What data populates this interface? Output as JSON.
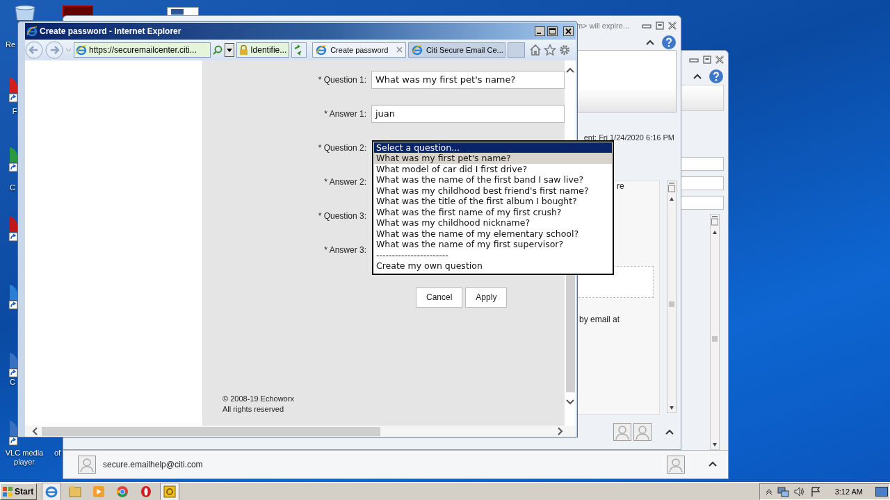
{
  "desktop_icons": [
    {
      "label": "Re"
    },
    {
      "label": "F"
    },
    {
      "label": "C"
    },
    {
      "label": "C"
    },
    {
      "label": "VLC media player"
    },
    {
      "label": "of"
    }
  ],
  "mail_window": {
    "title": "m> will expire...",
    "sent": "ent: Fri 1/24/2020 6:16 PM",
    "body_fragment": "re",
    "body_text": "by email at",
    "contact": "secure.emailhelp@citi.com"
  },
  "browser": {
    "title": "Create password - Internet Explorer",
    "address": "https://securemailcenter.citi...",
    "identity": "Identifie...",
    "tabs": [
      {
        "label": "Create password",
        "selected": true
      },
      {
        "label": "Citi Secure Email Ce...",
        "selected": false
      }
    ]
  },
  "form": {
    "rows": [
      {
        "label": "* Question 1:",
        "value": "What was my first pet's name?"
      },
      {
        "label": "* Answer 1:",
        "value": "juan"
      },
      {
        "label": "* Question 2:"
      },
      {
        "label": "* Answer 2:"
      },
      {
        "label": "* Question 3:"
      },
      {
        "label": "* Answer 3:"
      }
    ],
    "dropdown": {
      "options": [
        {
          "label": "Select a question...",
          "selected": true,
          "hovered": false
        },
        {
          "label": "What was my first pet's name?",
          "selected": false,
          "hovered": true
        },
        {
          "label": "What model of car did I first drive?",
          "selected": false,
          "hovered": false
        },
        {
          "label": "What was the name of the first band I saw live?",
          "selected": false,
          "hovered": false
        },
        {
          "label": "What was my childhood best friend's first name?",
          "selected": false,
          "hovered": false
        },
        {
          "label": "What was the title of the first album I bought?",
          "selected": false,
          "hovered": false
        },
        {
          "label": "What was the first name of my first crush?",
          "selected": false,
          "hovered": false
        },
        {
          "label": "What was my childhood nickname?",
          "selected": false,
          "hovered": false
        },
        {
          "label": "What was the name of my elementary school?",
          "selected": false,
          "hovered": false
        },
        {
          "label": "What was the name of my first supervisor?",
          "selected": false,
          "hovered": false
        },
        {
          "label": "-----------------------",
          "selected": false,
          "hovered": false
        },
        {
          "label": "Create my own question",
          "selected": false,
          "hovered": false
        }
      ]
    },
    "buttons": [
      "Cancel",
      "Apply"
    ],
    "footer": [
      "© 2008-19 Echoworx",
      "All rights reserved"
    ]
  },
  "taskbar": {
    "start": "Start",
    "clock": "3:12 AM"
  }
}
